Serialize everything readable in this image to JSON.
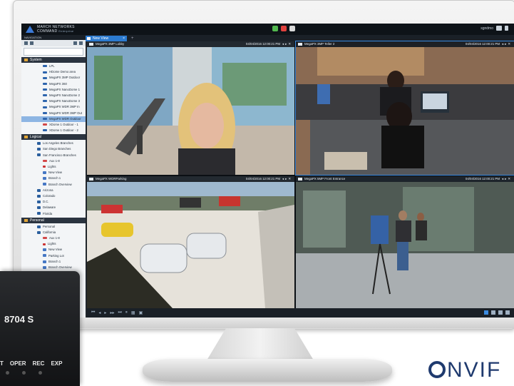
{
  "brand": {
    "line1": "MARCH NETWORKS",
    "line2": "COMMAND",
    "line3": "Enterprise"
  },
  "user": {
    "name": "sgndmo"
  },
  "tabs": [
    {
      "label": "New View",
      "active": true
    }
  ],
  "nav": {
    "title": "NAVIGATION",
    "sections": {
      "system": "System",
      "logical": "Logical",
      "personal": "Personal"
    },
    "system_items": [
      {
        "label": "LPL",
        "type": "camera"
      },
      {
        "label": "HDome Demo area",
        "type": "camera"
      },
      {
        "label": "MegaPX 3MP Outdoor",
        "type": "camera"
      },
      {
        "label": "MegaPX 360",
        "type": "camera"
      },
      {
        "label": "MegaPX NanoDome 1",
        "type": "camera"
      },
      {
        "label": "MegaPX NanoDome 2",
        "type": "camera"
      },
      {
        "label": "MegaPX NanoDome 3",
        "type": "camera"
      },
      {
        "label": "MegaPX WDR 3MP In",
        "type": "camera"
      },
      {
        "label": "MegaPX WDR 3MP Out",
        "type": "camera"
      },
      {
        "label": "MegaPX WDR Outdoor",
        "type": "camera",
        "selected": true
      },
      {
        "label": "XDome 1 Outdoor - 1",
        "type": "alert"
      },
      {
        "label": "XDome 1 Outdoor - 2",
        "type": "camera"
      }
    ],
    "logical_items": [
      {
        "label": "Los Angeles Branches",
        "type": "folder"
      },
      {
        "label": "San Diego Branches",
        "type": "folder"
      },
      {
        "label": "San Francisco Branches",
        "type": "folder"
      },
      {
        "label": "Aux 1-8",
        "type": "alert"
      },
      {
        "label": "Lights",
        "type": "flag"
      },
      {
        "label": "New View",
        "type": "grid"
      },
      {
        "label": "Branch 1",
        "type": "grid"
      },
      {
        "label": "Branch Overview",
        "type": "grid"
      },
      {
        "label": "Arizona",
        "type": "folder"
      },
      {
        "label": "Colorado",
        "type": "folder"
      },
      {
        "label": "D.C.",
        "type": "folder"
      },
      {
        "label": "Delaware",
        "type": "folder"
      },
      {
        "label": "Florida",
        "type": "folder"
      }
    ],
    "personal_items": [
      {
        "label": "Personal",
        "type": "folder"
      },
      {
        "label": "California",
        "type": "folder"
      },
      {
        "label": "Aux 1-8",
        "type": "alert"
      },
      {
        "label": "Lights",
        "type": "flag"
      },
      {
        "label": "New View",
        "type": "grid"
      },
      {
        "label": "Parking Lot",
        "type": "grid"
      },
      {
        "label": "Branch 1",
        "type": "grid"
      },
      {
        "label": "Branch Overview",
        "type": "grid"
      }
    ]
  },
  "tiles": [
    {
      "name": "MegaPX 3MP Lobby",
      "timestamp": "04/04/2016 12:00:21 PM"
    },
    {
      "name": "MegaPX 3MP Teller 2",
      "timestamp": "04/04/2016 12:00:21 PM"
    },
    {
      "name": "MegaPX WDRParking",
      "timestamp": "04/04/2016 12:00:21 PM"
    },
    {
      "name": "MegaPX 5MP Front Entrance",
      "timestamp": "04/04/2016 12:00:21 PM"
    }
  ],
  "device": {
    "model": "8704 S",
    "leds": [
      "T",
      "OPER",
      "REC",
      "EXP"
    ]
  },
  "onvif_logo": {
    "text": "NVIF"
  }
}
